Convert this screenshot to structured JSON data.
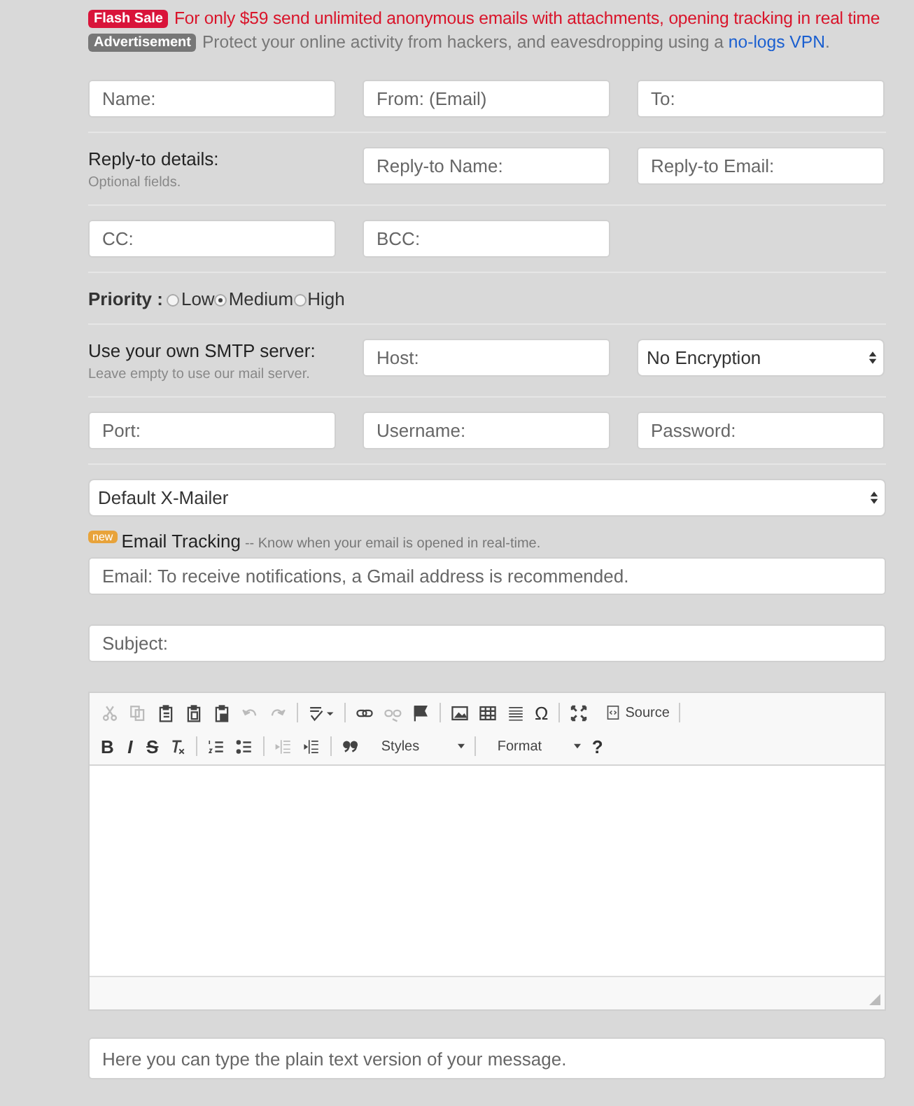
{
  "promo": [
    {
      "kind": "sale",
      "badge": "Flash Sale",
      "text": "For only $59 send unlimited anonymous emails with attachments, opening tracking in real time"
    },
    {
      "kind": "ad",
      "badge": "Advertisement",
      "text": "Protect your online activity from hackers, and eavesdropping using a ",
      "link": "no-logs VPN",
      "after": "."
    }
  ],
  "sender_row": [
    {
      "placeholder": "Name:"
    },
    {
      "placeholder": "From: (Email)"
    },
    {
      "placeholder": "To:"
    }
  ],
  "reply_to": {
    "label": "Reply-to details:",
    "note": "Optional fields.",
    "fields": [
      {
        "placeholder": "Reply-to Name:"
      },
      {
        "placeholder": "Reply-to Email:"
      }
    ]
  },
  "copy_row": [
    {
      "placeholder": "CC:"
    },
    {
      "placeholder": "BCC:"
    }
  ],
  "priority": {
    "label": "Priority :",
    "options": [
      {
        "label": "Low",
        "selected": false
      },
      {
        "label": "Medium",
        "selected": true
      },
      {
        "label": "High",
        "selected": false
      }
    ]
  },
  "smtp": {
    "label": "Use your own SMTP server:",
    "note": "Leave empty to use our mail server.",
    "host": {
      "placeholder": "Host:"
    },
    "encryption": "No Encryption"
  },
  "login_row": [
    {
      "placeholder": "Port:"
    },
    {
      "placeholder": "Username:"
    },
    {
      "placeholder": "Password:"
    }
  ],
  "x_mailer": "Default X-Mailer",
  "email_tracking": {
    "badge": "new",
    "label": "Email Tracking",
    "hint": "-- Know when your email is opened in real-time.",
    "field": {
      "placeholder": "Email: To receive notifications, a Gmail address is recommended."
    }
  },
  "subject": {
    "placeholder": "Subject:"
  },
  "editor": {
    "toolbar": [
      [
        {
          "kind": "icon",
          "disabled": true
        },
        {
          "kind": "icon",
          "disabled": true
        },
        {
          "kind": "icon",
          "disabled": false
        },
        {
          "kind": "icon",
          "disabled": false
        },
        {
          "kind": "icon",
          "disabled": false
        },
        {
          "kind": "icon",
          "disabled": true
        },
        {
          "kind": "icon",
          "disabled": true
        },
        {
          "kind": "separator"
        },
        {
          "kind": "icon_menu",
          "disabled": false
        },
        {
          "kind": "separator"
        },
        {
          "kind": "icon",
          "disabled": false
        },
        {
          "kind": "icon",
          "disabled": true
        },
        {
          "kind": "icon",
          "disabled": false
        },
        {
          "kind": "separator"
        },
        {
          "kind": "icon",
          "disabled": false
        },
        {
          "kind": "icon",
          "disabled": false
        },
        {
          "kind": "icon",
          "disabled": false
        },
        {
          "kind": "text",
          "label": "Ω"
        },
        {
          "kind": "separator"
        },
        {
          "kind": "icon",
          "disabled": false
        },
        {
          "kind": "source",
          "label": "Source"
        },
        {
          "kind": "separator"
        }
      ],
      [
        {
          "kind": "text",
          "label": "B"
        },
        {
          "kind": "text",
          "label": "I"
        },
        {
          "kind": "text",
          "label": "S"
        },
        {
          "kind": "icon",
          "disabled": false
        },
        {
          "kind": "separator"
        },
        {
          "kind": "icon",
          "disabled": false
        },
        {
          "kind": "icon",
          "disabled": false
        },
        {
          "kind": "separator"
        },
        {
          "kind": "icon",
          "disabled": true
        },
        {
          "kind": "icon",
          "disabled": false
        },
        {
          "kind": "separator"
        },
        {
          "kind": "icon",
          "disabled": false
        },
        {
          "kind": "dropdown",
          "label": "Styles"
        },
        {
          "kind": "separator"
        },
        {
          "kind": "dropdown",
          "label": "Format"
        },
        {
          "kind": "text",
          "label": "?"
        }
      ]
    ]
  },
  "plain_text": {
    "placeholder": "Here you can type the plain text version of your message."
  }
}
